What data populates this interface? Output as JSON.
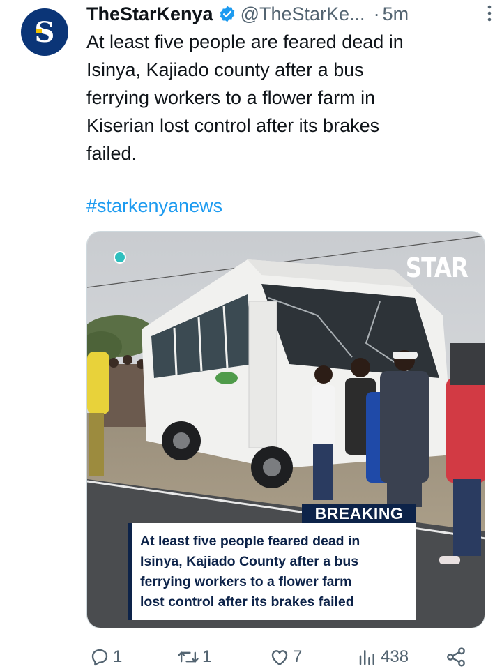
{
  "account": {
    "display_name": "TheStarKenya",
    "handle": "@TheStarKe...",
    "separator": "·",
    "time": "5m",
    "verified_icon": "verified-badge-icon",
    "avatar_letter": "S",
    "avatar_color": "#0b3577"
  },
  "tweet": {
    "lines": [
      "At least five people are feared dead in",
      "Isinya, Kajiado county after a bus",
      "ferrying workers to a flower farm in",
      "Kiserian lost control after its brakes",
      "failed."
    ],
    "hashtag": "#starkenyanews"
  },
  "media": {
    "brand": "STAR",
    "badge": "BREAKING",
    "headline_lines": [
      "At least five people feared dead in",
      "Isinya, Kajiado County after a bus",
      "ferrying workers to a flower farm",
      "lost control after its brakes failed"
    ],
    "badge_color": "#0d2349"
  },
  "actions": {
    "replies": "1",
    "retweets": "1",
    "likes": "7",
    "views": "438"
  },
  "colors": {
    "link": "#1d9bf0",
    "muted": "#536471",
    "text": "#0f1419"
  }
}
